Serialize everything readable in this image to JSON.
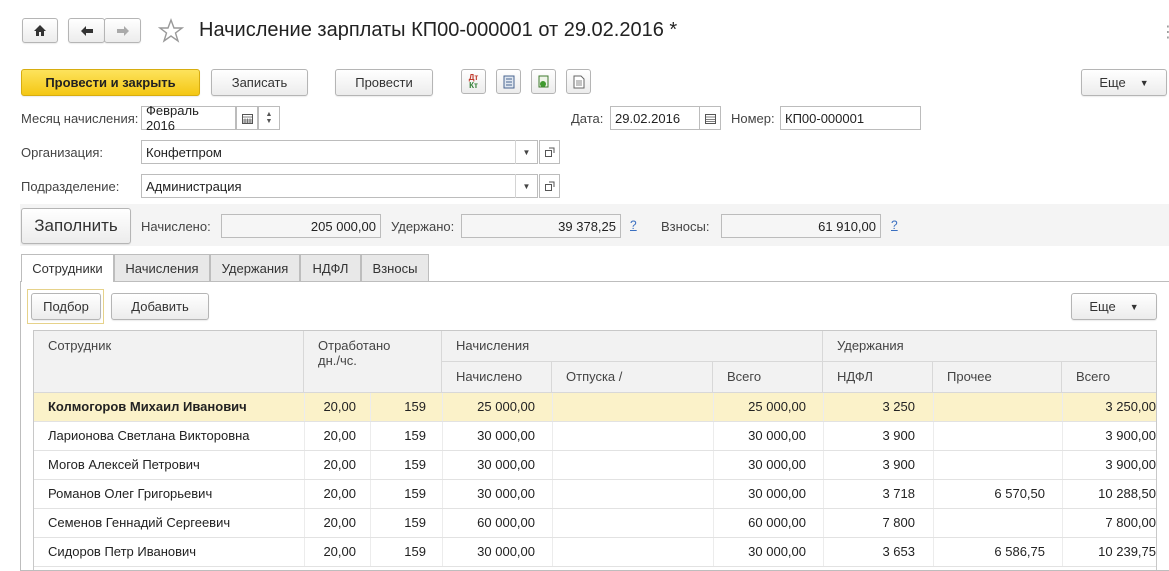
{
  "header": {
    "title": "Начисление зарплаты КП00-000001 от 29.02.2016 *",
    "home_icon": "home-icon",
    "back_icon": "arrow-left-icon",
    "forward_icon": "arrow-right-icon",
    "star_icon": "star-icon"
  },
  "toolbar": {
    "post_close": "Провести и закрыть",
    "save": "Записать",
    "post": "Провести",
    "more": "Еще",
    "icons": [
      "dt-kt-icon",
      "register-icon",
      "print-settings-icon",
      "document-icon"
    ]
  },
  "form": {
    "month_label": "Месяц начисления:",
    "month_value": "Февраль 2016",
    "date_label": "Дата:",
    "date_value": "29.02.2016",
    "number_label": "Номер:",
    "number_value": "КП00-000001",
    "org_label": "Организация:",
    "org_value": "Конфетпром",
    "dept_label": "Подразделение:",
    "dept_value": "Администрация"
  },
  "totals": {
    "fill_button": "Заполнить",
    "accrued_label": "Начислено:",
    "accrued_value": "205 000,00",
    "withheld_label": "Удержано:",
    "withheld_value": "39 378,25",
    "contrib_label": "Взносы:",
    "contrib_value": "61 910,00",
    "help": "?"
  },
  "tabs": [
    "Сотрудники",
    "Начисления",
    "Удержания",
    "НДФЛ",
    "Взносы"
  ],
  "table_toolbar": {
    "pick": "Подбор",
    "add": "Добавить",
    "more": "Еще"
  },
  "table": {
    "headers": {
      "employee": "Сотрудник",
      "worked": "Отработано",
      "worked_sub": "дн./чс.",
      "accruals": "Начисления",
      "accrued": "Начислено",
      "vacation": "Отпуска /",
      "accr_total": "Всего",
      "deductions": "Удержания",
      "ndfl": "НДФЛ",
      "other": "Прочее",
      "ded_total": "Всего"
    },
    "rows": [
      {
        "name": "Колмогоров Михаил Иванович",
        "days": "20,00",
        "hours": "159",
        "accrued": "25 000,00",
        "vacation": "",
        "total": "25 000,00",
        "ndfl": "3 250",
        "other": "",
        "ded_total": "3 250,00"
      },
      {
        "name": "Ларионова Светлана Викторовна",
        "days": "20,00",
        "hours": "159",
        "accrued": "30 000,00",
        "vacation": "",
        "total": "30 000,00",
        "ndfl": "3 900",
        "other": "",
        "ded_total": "3 900,00"
      },
      {
        "name": "Могов Алексей Петрович",
        "days": "20,00",
        "hours": "159",
        "accrued": "30 000,00",
        "vacation": "",
        "total": "30 000,00",
        "ndfl": "3 900",
        "other": "",
        "ded_total": "3 900,00"
      },
      {
        "name": "Романов Олег Григорьевич",
        "days": "20,00",
        "hours": "159",
        "accrued": "30 000,00",
        "vacation": "",
        "total": "30 000,00",
        "ndfl": "3 718",
        "other": "6 570,50",
        "ded_total": "10 288,50"
      },
      {
        "name": "Семенов Геннадий Сергеевич",
        "days": "20,00",
        "hours": "159",
        "accrued": "60 000,00",
        "vacation": "",
        "total": "60 000,00",
        "ndfl": "7 800",
        "other": "",
        "ded_total": "7 800,00"
      },
      {
        "name": "Сидоров Петр Иванович",
        "days": "20,00",
        "hours": "159",
        "accrued": "30 000,00",
        "vacation": "",
        "total": "30 000,00",
        "ndfl": "3 653",
        "other": "6 586,75",
        "ded_total": "10 239,75"
      }
    ]
  }
}
